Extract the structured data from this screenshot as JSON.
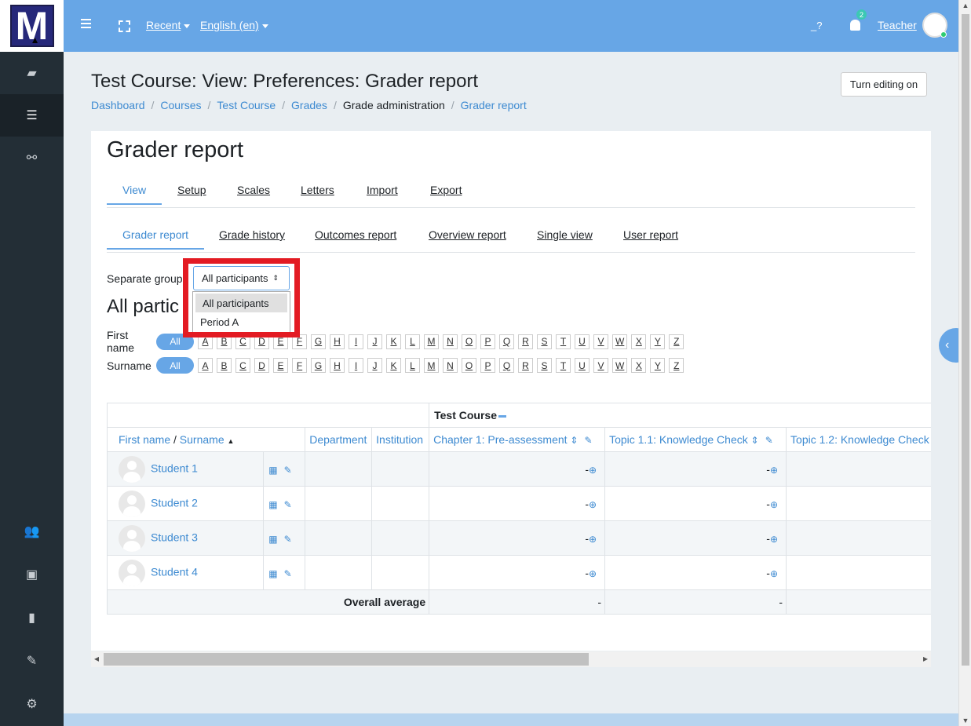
{
  "topbar": {
    "logo_letter": "M",
    "recent": "Recent",
    "language": "English (en)",
    "help": "_?",
    "notif_count": "2",
    "user": "Teacher"
  },
  "page": {
    "title": "Test Course: View: Preferences: Grader report",
    "edit_button": "Turn editing on",
    "breadcrumb": [
      "Dashboard",
      "Courses",
      "Test Course",
      "Grades",
      "Grade administration",
      "Grader report"
    ],
    "heading": "Grader report"
  },
  "tabs1": [
    "View",
    "Setup",
    "Scales",
    "Letters",
    "Import",
    "Export"
  ],
  "tabs2": [
    "Grader report",
    "Grade history",
    "Outcomes report",
    "Overview report",
    "Single view",
    "User report"
  ],
  "groups": {
    "label": "Separate groups",
    "selected": "All participants",
    "options": [
      "All participants",
      "Period A"
    ],
    "heading": "All partic"
  },
  "filters": {
    "firstname_label": "First name",
    "surname_label": "Surname",
    "all": "All",
    "letters": [
      "A",
      "B",
      "C",
      "D",
      "E",
      "F",
      "G",
      "H",
      "I",
      "J",
      "K",
      "L",
      "M",
      "N",
      "O",
      "P",
      "Q",
      "R",
      "S",
      "T",
      "U",
      "V",
      "W",
      "X",
      "Y",
      "Z"
    ]
  },
  "table": {
    "course": "Test Course",
    "first_name": "First name",
    "surname": "Surname",
    "department": "Department",
    "institution": "Institution",
    "col1": "Chapter 1: Pre-assessment",
    "col2": "Topic 1.1: Knowledge Check",
    "col3": "Topic 1.2: Knowledge Check",
    "students": [
      "Student 1",
      "Student 2",
      "Student 3",
      "Student 4"
    ],
    "dash": "-",
    "overall": "Overall average"
  }
}
